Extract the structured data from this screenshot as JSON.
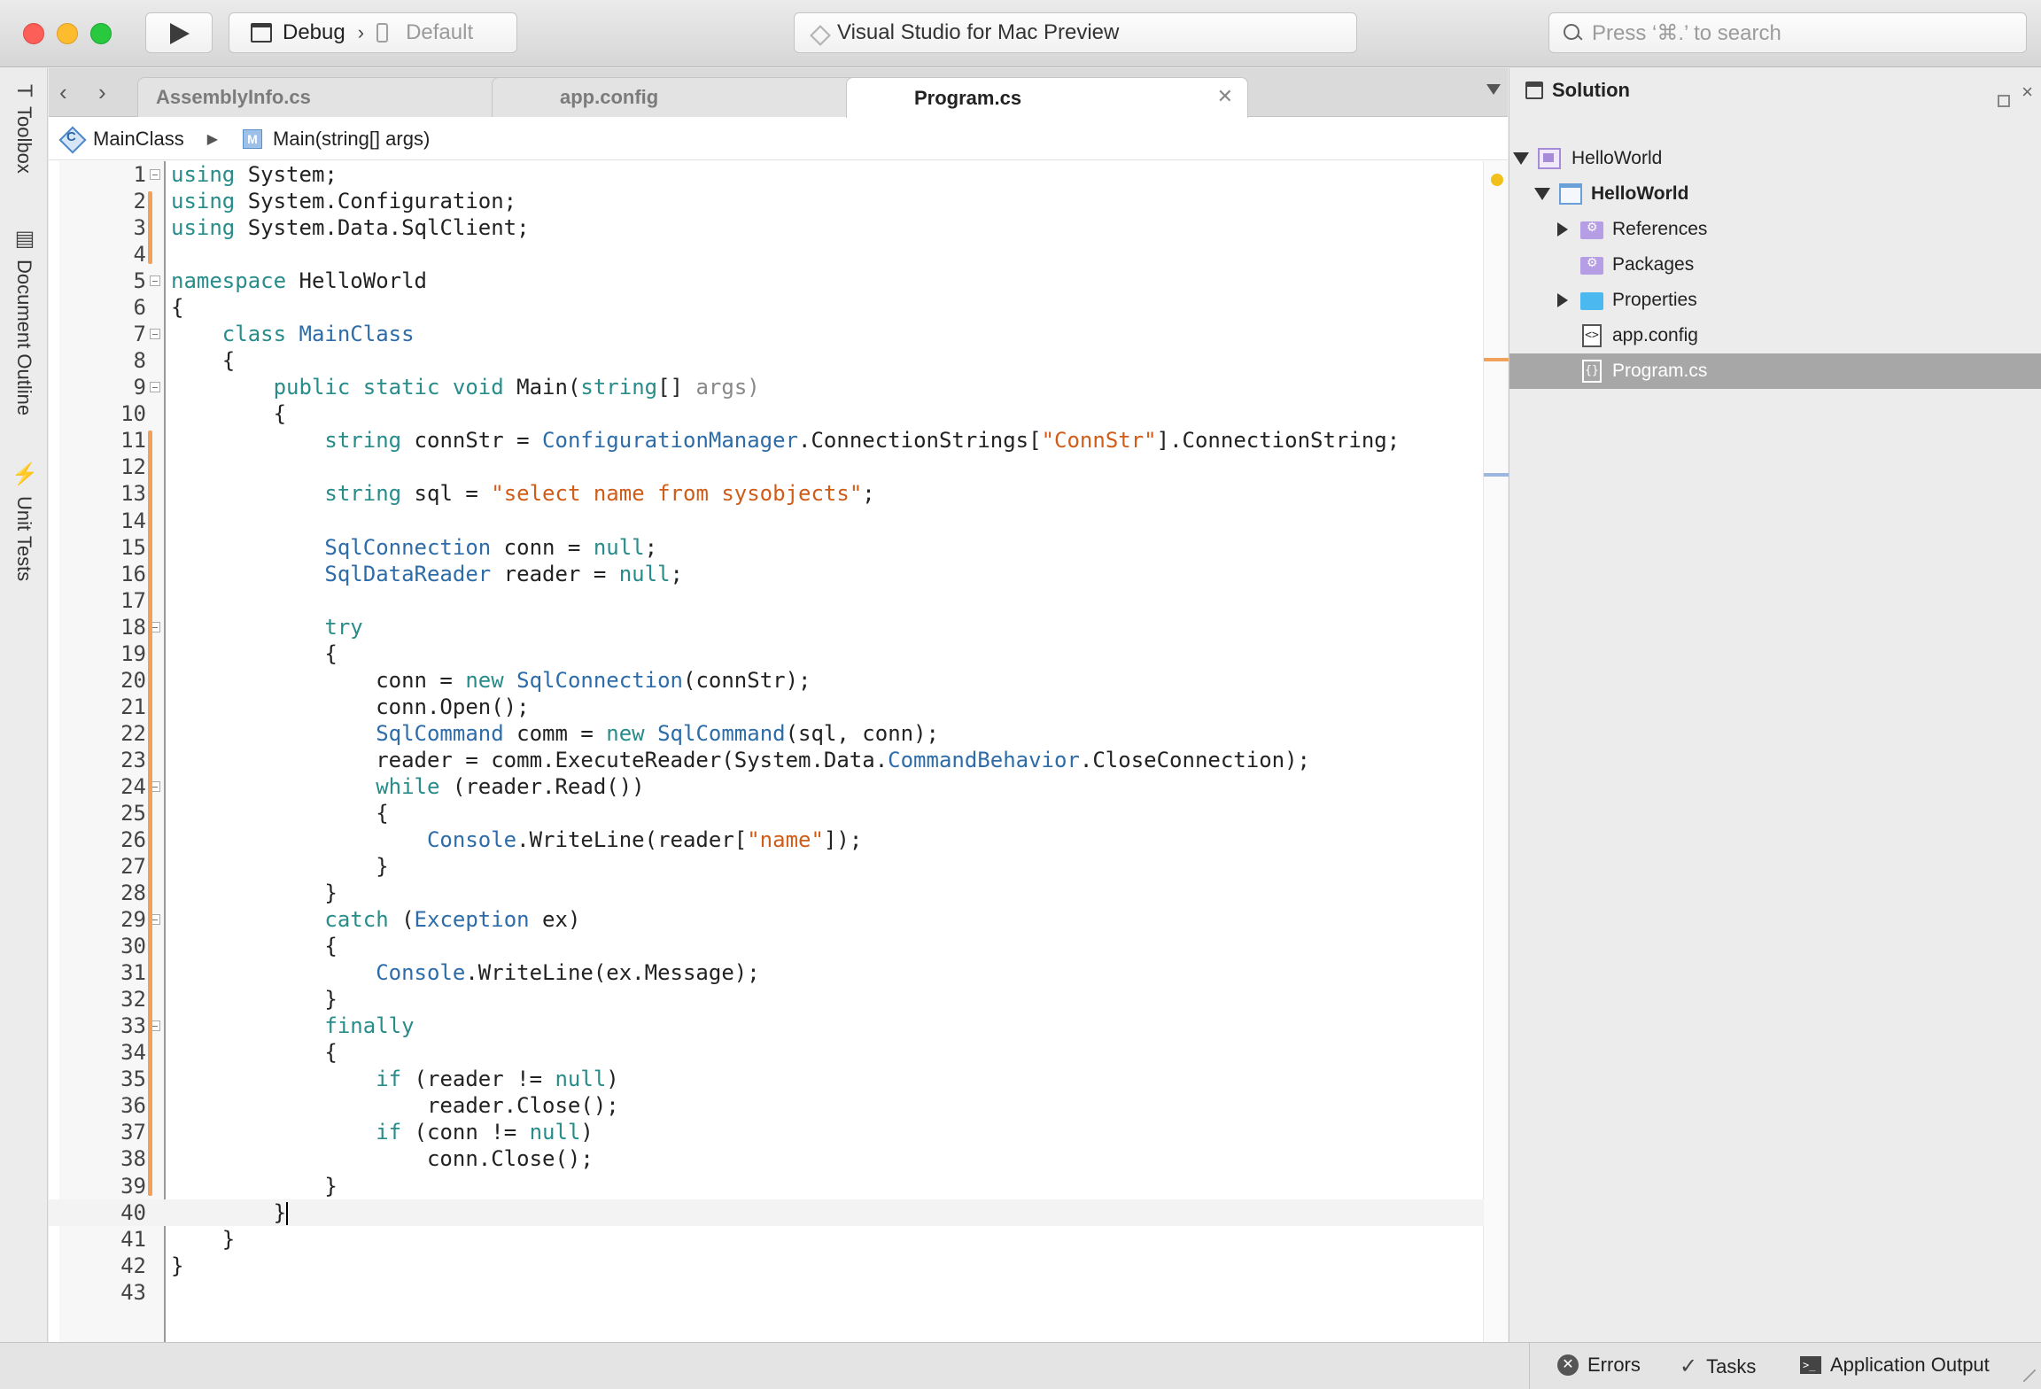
{
  "titlebar": {
    "config": "Debug",
    "device": "Default",
    "status_text": "Visual Studio for Mac Preview",
    "search_placeholder": "Press ‘⌘.’ to search"
  },
  "left_pads": {
    "toolbox": "Toolbox",
    "document_outline": "Document Outline",
    "unit_tests": "Unit Tests"
  },
  "tabs": [
    {
      "label": "AssemblyInfo.cs",
      "active": false
    },
    {
      "label": "app.config",
      "active": false,
      "modified": true
    },
    {
      "label": "Program.cs",
      "active": true
    }
  ],
  "path": {
    "class_icon_letter": "C",
    "class": "MainClass",
    "method_icon_letter": "M",
    "method": "Main(string[] args)"
  },
  "editor": {
    "current_line": 40,
    "lines": [
      {
        "n": "1"
      },
      {
        "n": "2"
      },
      {
        "n": "3"
      },
      {
        "n": "4"
      },
      {
        "n": "5"
      },
      {
        "n": "6"
      },
      {
        "n": "7"
      },
      {
        "n": "8"
      },
      {
        "n": "9"
      },
      {
        "n": "10"
      },
      {
        "n": "11"
      },
      {
        "n": "12"
      },
      {
        "n": "13"
      },
      {
        "n": "14"
      },
      {
        "n": "15"
      },
      {
        "n": "16"
      },
      {
        "n": "17"
      },
      {
        "n": "18"
      },
      {
        "n": "19"
      },
      {
        "n": "20"
      },
      {
        "n": "21"
      },
      {
        "n": "22"
      },
      {
        "n": "23"
      },
      {
        "n": "24"
      },
      {
        "n": "25"
      },
      {
        "n": "26"
      },
      {
        "n": "27"
      },
      {
        "n": "28"
      },
      {
        "n": "29"
      },
      {
        "n": "30"
      },
      {
        "n": "31"
      },
      {
        "n": "32"
      },
      {
        "n": "33"
      },
      {
        "n": "34"
      },
      {
        "n": "35"
      },
      {
        "n": "36"
      },
      {
        "n": "37"
      },
      {
        "n": "38"
      },
      {
        "n": "39"
      },
      {
        "n": "40"
      },
      {
        "n": "41"
      },
      {
        "n": "42"
      },
      {
        "n": "43"
      }
    ],
    "code": [
      [
        {
          "k": "using"
        },
        " System;"
      ],
      [
        {
          "k": "using"
        },
        " System.Configuration;"
      ],
      [
        {
          "k": "using"
        },
        " System.Data.SqlClient;"
      ],
      [
        ""
      ],
      [
        {
          "k": "namespace"
        },
        " HelloWorld"
      ],
      [
        "{"
      ],
      [
        "    ",
        {
          "k": "class"
        },
        " ",
        {
          "t": "MainClass"
        }
      ],
      [
        "    {"
      ],
      [
        "        ",
        {
          "k": "public"
        },
        " ",
        {
          "k": "static"
        },
        " ",
        {
          "k": "void"
        },
        " Main(",
        {
          "k": "string"
        },
        "[] ",
        {
          "g": "args"
        },
        {
          "g": ")"
        }
      ],
      [
        "        {"
      ],
      [
        "            ",
        {
          "k": "string"
        },
        " connStr = ",
        {
          "t": "ConfigurationManager"
        },
        ".ConnectionStrings[",
        {
          "s": "\"ConnStr\""
        },
        "].ConnectionString;"
      ],
      [
        ""
      ],
      [
        "            ",
        {
          "k": "string"
        },
        " sql = ",
        {
          "s": "\"select name from sysobjects\""
        },
        ";"
      ],
      [
        ""
      ],
      [
        "            ",
        {
          "t": "SqlConnection"
        },
        " conn = ",
        {
          "k": "null"
        },
        ";"
      ],
      [
        "            ",
        {
          "t": "SqlDataReader"
        },
        " reader = ",
        {
          "k": "null"
        },
        ";"
      ],
      [
        ""
      ],
      [
        "            ",
        {
          "k": "try"
        }
      ],
      [
        "            {"
      ],
      [
        "                conn = ",
        {
          "k": "new"
        },
        " ",
        {
          "t": "SqlConnection"
        },
        "(connStr);"
      ],
      [
        "                conn.Open();"
      ],
      [
        "                ",
        {
          "t": "SqlCommand"
        },
        " comm = ",
        {
          "k": "new"
        },
        " ",
        {
          "t": "SqlCommand"
        },
        "(sql, conn);"
      ],
      [
        "                reader = comm.ExecuteReader(System.Data.",
        {
          "t": "CommandBehavior"
        },
        ".CloseConnection);"
      ],
      [
        "                ",
        {
          "k": "while"
        },
        " (reader.Read())"
      ],
      [
        "                {"
      ],
      [
        "                    ",
        {
          "t": "Console"
        },
        ".WriteLine(reader[",
        {
          "s": "\"name\""
        },
        "]);"
      ],
      [
        "                }"
      ],
      [
        "            }"
      ],
      [
        "            ",
        {
          "k": "catch"
        },
        " (",
        {
          "t": "Exception"
        },
        " ex)"
      ],
      [
        "            {"
      ],
      [
        "                ",
        {
          "t": "Console"
        },
        ".WriteLine(ex.Message);"
      ],
      [
        "            }"
      ],
      [
        "            ",
        {
          "k": "finally"
        }
      ],
      [
        "            {"
      ],
      [
        "                ",
        {
          "k": "if"
        },
        " (reader != ",
        {
          "k": "null"
        },
        ")"
      ],
      [
        "                    reader.Close();"
      ],
      [
        "                ",
        {
          "k": "if"
        },
        " (conn != ",
        {
          "k": "null"
        },
        ")"
      ],
      [
        "                    conn.Close();"
      ],
      [
        "            }"
      ],
      [
        "        }"
      ],
      [
        "    }"
      ],
      [
        "}"
      ],
      [
        ""
      ]
    ],
    "fold_lines": [
      1,
      5,
      7,
      9,
      18,
      24,
      29,
      33
    ],
    "changed_ranges": [
      [
        2,
        4
      ],
      [
        11,
        39
      ]
    ]
  },
  "solution": {
    "title": "Solution",
    "tree": [
      {
        "label": "HelloWorld",
        "bold": false
      },
      {
        "label": "HelloWorld",
        "bold": true
      },
      {
        "label": "References"
      },
      {
        "label": "Packages"
      },
      {
        "label": "Properties"
      },
      {
        "label": "app.config",
        "icon_text": "<>"
      },
      {
        "label": "Program.cs",
        "icon_text": "{}",
        "selected": true
      }
    ]
  },
  "statusbar": {
    "errors": "Errors",
    "tasks": "Tasks",
    "output": "Application Output"
  },
  "colors": {
    "keyword": "#278c8a",
    "type": "#2d6ca8",
    "string": "#d05c18",
    "change_marker": "#f2a15b",
    "selection": "#a7a7a7"
  }
}
